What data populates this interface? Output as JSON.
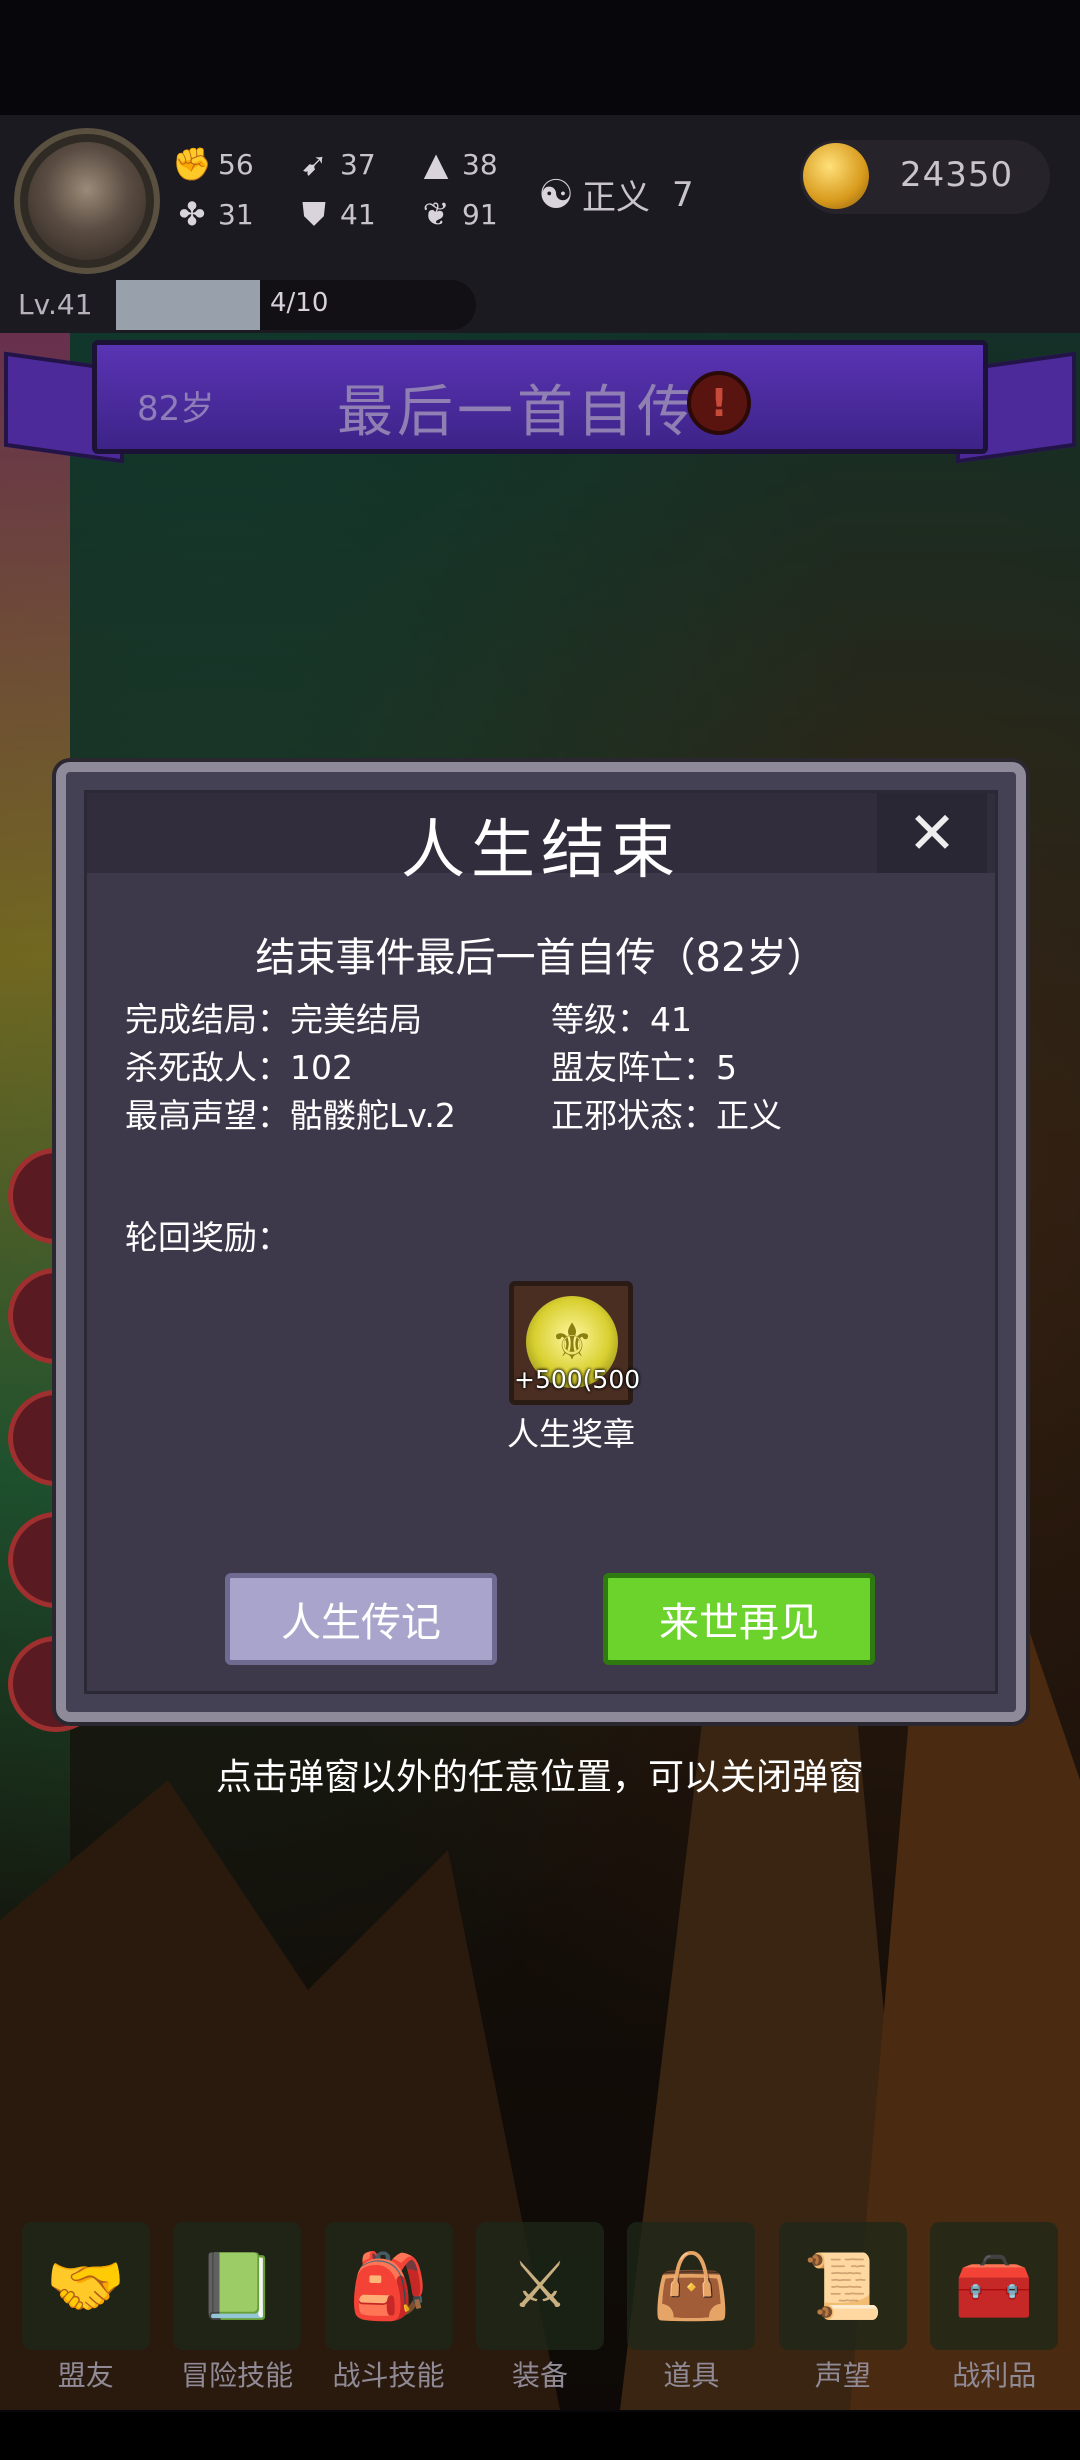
{
  "player": {
    "stats": [
      {
        "icon": "fist-icon",
        "value": "56"
      },
      {
        "icon": "clover-icon",
        "value": "31"
      },
      {
        "icon": "boot-icon",
        "value": "37"
      },
      {
        "icon": "armor-icon",
        "value": "41"
      },
      {
        "icon": "wizard-hat-icon",
        "value": "38"
      },
      {
        "icon": "lotus-icon",
        "value": "91"
      }
    ],
    "alignment_label": "正义",
    "alignment_value": "7",
    "gold": "24350",
    "level": "Lv.41",
    "xp_text": "4/10",
    "xp_fraction": 0.4
  },
  "event_banner": {
    "age": "82岁",
    "title": "最后一首自传",
    "alert_glyph": "!"
  },
  "modal": {
    "title": "人生结束",
    "close_glyph": "✕",
    "subtitle": "结束事件最后一首自传（82岁）",
    "rows": {
      "ending": "完成结局：完美结局",
      "level": "等级：41",
      "kills": "杀死敌人：102",
      "ally_deaths": "盟友阵亡：5",
      "reputation": "最高声望：骷髅舵Lv.2",
      "alignment": "正邪状态：正义"
    },
    "reward_label": "轮回奖励：",
    "reward": {
      "icon": "life-medal-icon",
      "count": "+500(500",
      "name": "人生奖章"
    },
    "buttons": {
      "biography": "人生传记",
      "next_life": "来世再见"
    }
  },
  "hint": "点击弹窗以外的任意位置，可以关闭弹窗",
  "nav": [
    {
      "label": "盟友",
      "icon": "handshake-icon"
    },
    {
      "label": "冒险技能",
      "icon": "book-icon"
    },
    {
      "label": "战斗技能",
      "icon": "backpack-icon"
    },
    {
      "label": "装备",
      "icon": "crossed-swords-icon"
    },
    {
      "label": "道具",
      "icon": "satchel-icon"
    },
    {
      "label": "声望",
      "icon": "scroll-icon"
    },
    {
      "label": "战利品",
      "icon": "treasure-chest-icon"
    }
  ],
  "colors": {
    "accent_green": "#6cd22c",
    "ribbon_purple": "#4c2a9a",
    "modal_bg": "#3d394b"
  }
}
